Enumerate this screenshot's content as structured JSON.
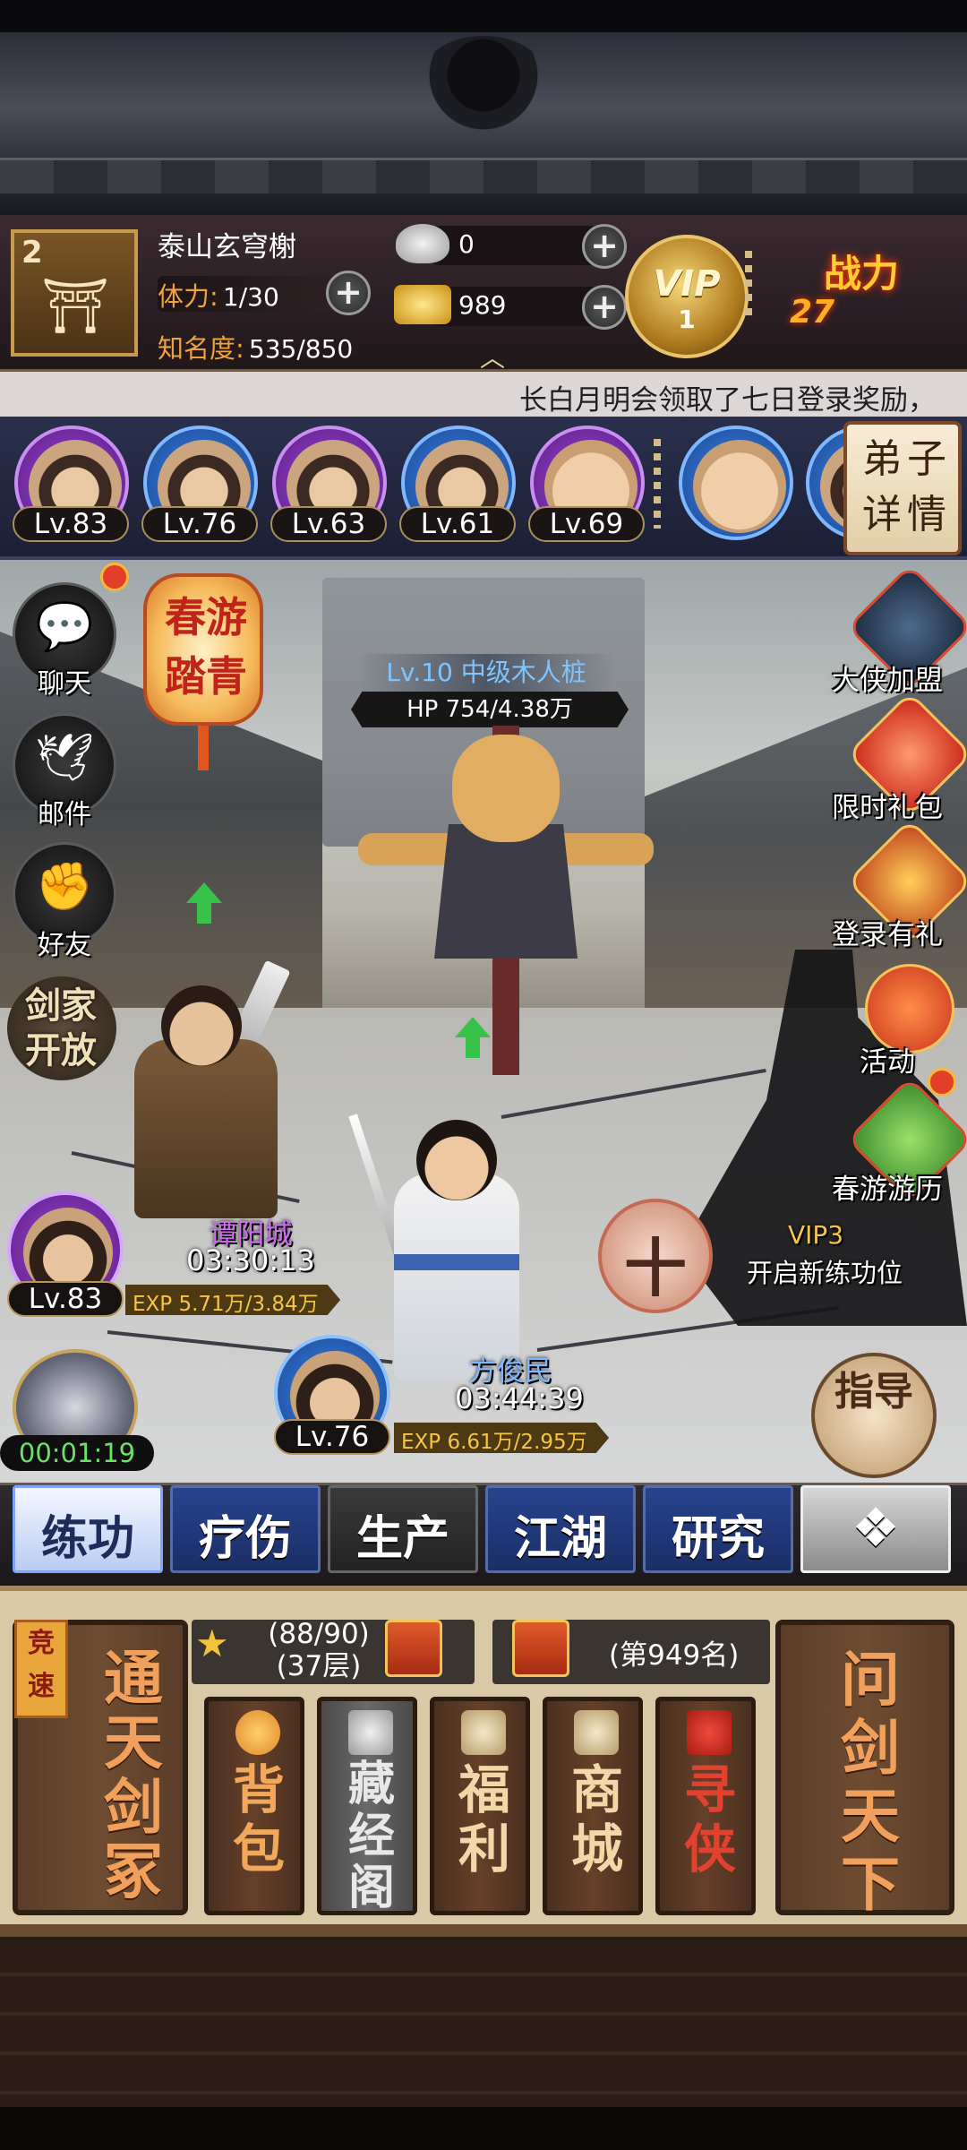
{
  "player": {
    "level": "2",
    "name": "泰山玄穹榭",
    "stamina_label": "体力:",
    "stamina_value": "1/30",
    "fame_label": "知名度:",
    "fame_value": "535/850"
  },
  "currency": {
    "silver": "0",
    "gold": "989"
  },
  "vip": {
    "label": "VIP",
    "level": "1"
  },
  "power": {
    "label": "战力",
    "value": "27"
  },
  "marquee": "长白月明会领取了七日登录奖励，",
  "disciples": [
    {
      "level": "Lv.83",
      "rarity": "purple"
    },
    {
      "level": "Lv.76",
      "rarity": "blue"
    },
    {
      "level": "Lv.63",
      "rarity": "purple"
    },
    {
      "level": "Lv.61",
      "rarity": "blue"
    },
    {
      "level": "Lv.69",
      "rarity": "purple"
    }
  ],
  "disciple_detail_label": "弟子详情",
  "side_buttons": {
    "chat": "聊天",
    "mail": "邮件",
    "friends": "好友",
    "sword_home": "剑家开放"
  },
  "spring_event": "春游踏青",
  "target": {
    "name": "Lv.10 中级木人桩",
    "hp": "HP 754/4.38万"
  },
  "heroes": [
    {
      "name": "谭阳城",
      "time": "03:30:13",
      "level": "Lv.83",
      "exp": "EXP 5.71万/3.84万"
    },
    {
      "name": "方俊民",
      "time": "03:44:39",
      "level": "Lv.76",
      "exp": "EXP 6.61万/2.95万"
    }
  ],
  "vip_slot": {
    "vip": "VIP3",
    "text": "开启新练功位"
  },
  "guide_label": "指导",
  "timer": "00:01:19",
  "events": [
    "大侠加盟",
    "限时礼包",
    "登录有礼",
    "活动",
    "春游游历"
  ],
  "tabs": [
    "练功",
    "疗伤",
    "生产",
    "江湖",
    "研究"
  ],
  "panel": {
    "speed_label": "竞速",
    "tongtian": "通天剑冢",
    "star_count": "(88/90)",
    "star_floor": "(37层)",
    "rank": "(第949名)",
    "wenjian": "问剑天下",
    "menu": [
      "背包",
      "藏经阁",
      "福利",
      "商城",
      "寻侠"
    ]
  },
  "colors": {
    "accent_gold": "#f0a23c",
    "tab_blue": "#27448e",
    "exp_yellow": "#f5c544",
    "timer_green": "#6be06b"
  }
}
